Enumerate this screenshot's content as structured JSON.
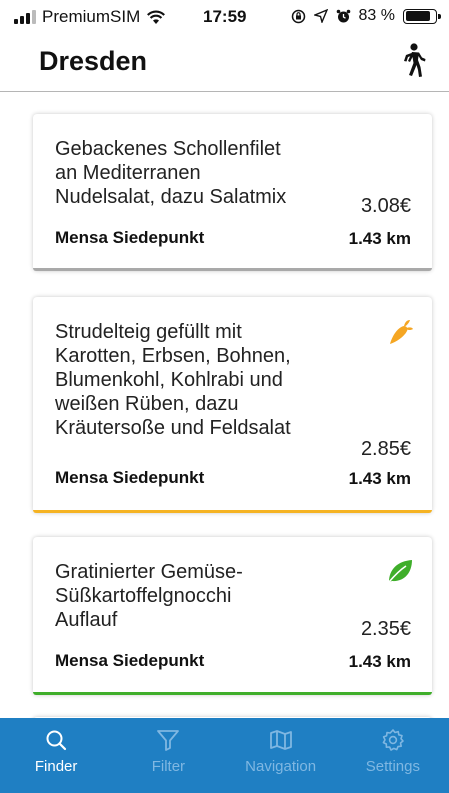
{
  "status_bar": {
    "carrier": "PremiumSIM",
    "time": "17:59",
    "battery": "83 %",
    "battery_level": 0.83
  },
  "header": {
    "title": "Dresden",
    "walk_icon": "walking-person-icon"
  },
  "meals": [
    {
      "title": "Gebackenes Schollenfilet\nan Mediterranen\nNudelsalat, dazu Salatmix",
      "price": "3.08€",
      "mensa": "Mensa Siedepunkt",
      "distance": "1.43 km",
      "icon": null,
      "bar_color": "#a9a9a9"
    },
    {
      "title": "Strudelteig gefüllt mit\nKarotten, Erbsen, Bohnen,\nBlumenkohl, Kohlrabi und\nweißen Rüben, dazu\nKräutersoße und Feldsalat",
      "price": "2.85€",
      "mensa": "Mensa Siedepunkt",
      "distance": "1.43 km",
      "icon": "carrot-icon",
      "icon_color": "#f5a623",
      "bar_color": "#f5b323"
    },
    {
      "title": "Gratinierter Gemüse-\nSüßkartoffelgnocchi\nAuflauf",
      "price": "2.35€",
      "mensa": "Mensa Siedepunkt",
      "distance": "1.43 km",
      "icon": "leaf-icon",
      "icon_color": "#3fae2a",
      "bar_color": "#3fae2a"
    }
  ],
  "tabs": [
    {
      "label": "Finder",
      "icon": "search-icon",
      "active": true
    },
    {
      "label": "Filter",
      "icon": "filter-icon",
      "active": false
    },
    {
      "label": "Navigation",
      "icon": "map-icon",
      "active": false
    },
    {
      "label": "Settings",
      "icon": "gear-icon",
      "active": false
    }
  ],
  "colors": {
    "accent": "#1f7fc3",
    "tab_inactive": "#7fb7e2",
    "tab_active": "#ffffff"
  }
}
